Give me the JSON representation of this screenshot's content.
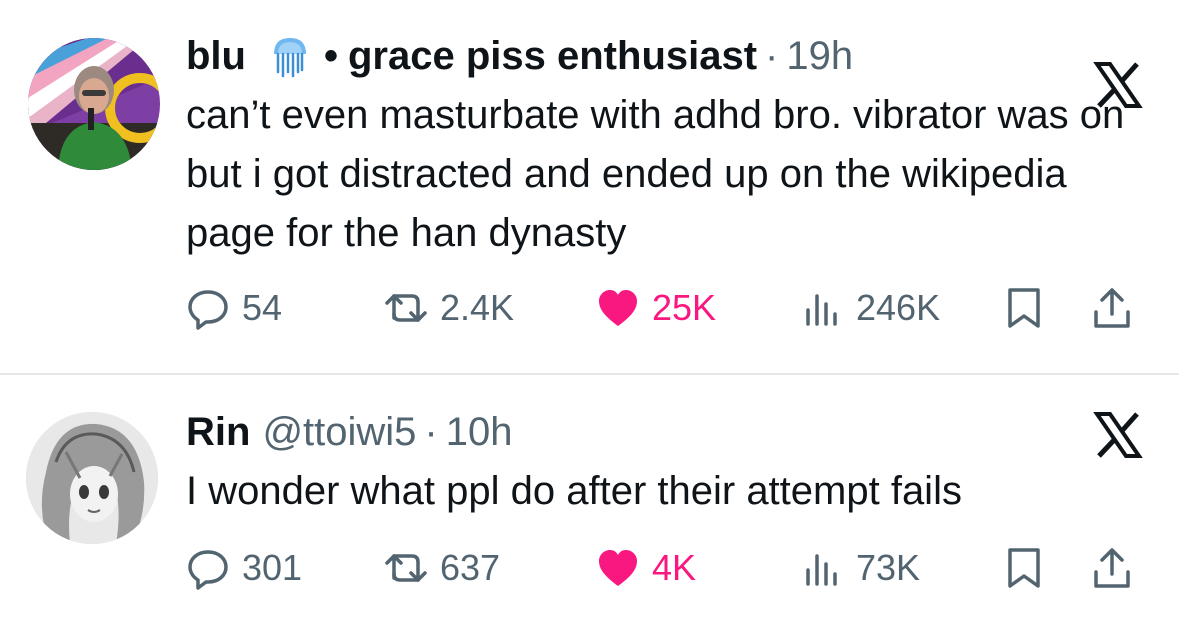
{
  "tweets": [
    {
      "author_name": "blu",
      "badge_icon": "jellyfish-icon",
      "separator": "•",
      "community": "grace piss enthusiast",
      "dot": "·",
      "time": "19h",
      "text": "can’t even masturbate with adhd bro. vibrator was on but i got distracted and ended up on the wikipedia page for the han dynasty",
      "replies": "54",
      "retweets": "2.4K",
      "likes": "25K",
      "views": "246K"
    },
    {
      "author_name": "Rin",
      "handle": "@ttoiwi5",
      "dot": "·",
      "time": "10h",
      "text": "I wonder what ppl do after their attempt fails",
      "replies": "301",
      "retweets": "637",
      "likes": "4K",
      "views": "73K"
    }
  ],
  "colors": {
    "text": "#0f1419",
    "secondary": "#536471",
    "like": "#f91880",
    "divider": "#e4e6e8"
  }
}
